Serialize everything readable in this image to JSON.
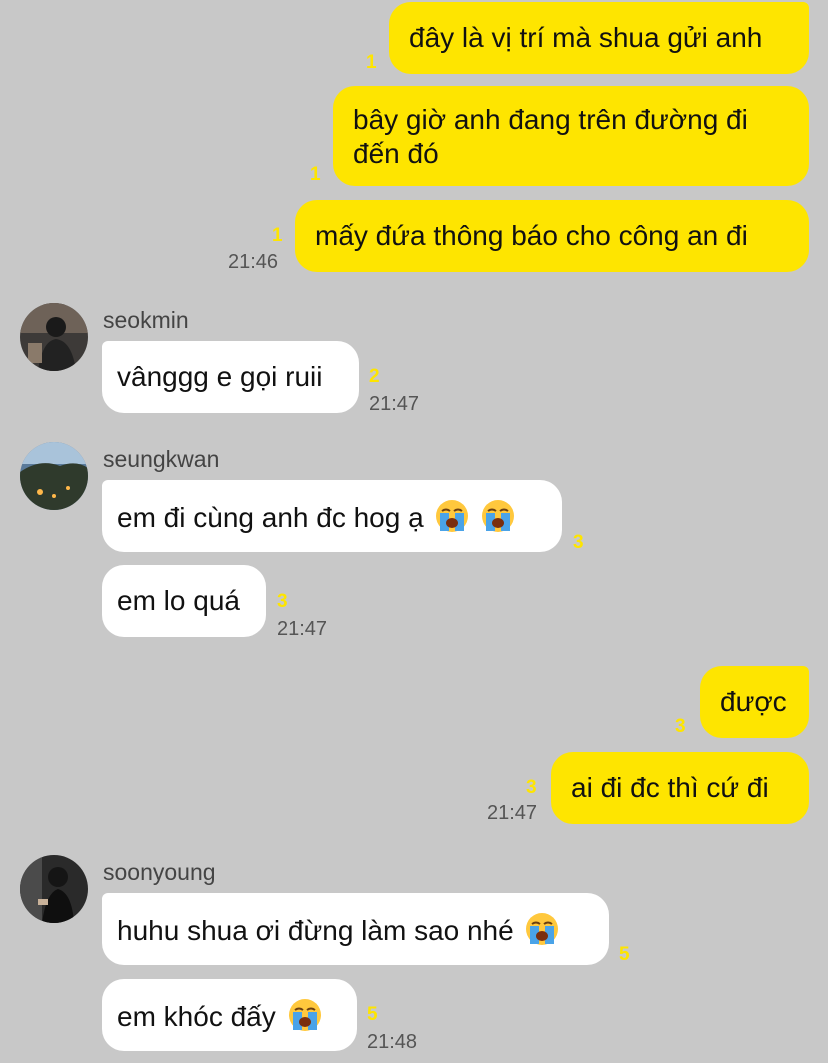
{
  "conversation": {
    "block1": {
      "msg1": "đây là vị trí mà shua gửi anh",
      "msg1_unread": "1",
      "msg2_line1": "bây giờ anh đang trên đường đi",
      "msg2_line2": "đến đó",
      "msg2_unread": "1",
      "msg3": "mấy đứa thông báo cho công an đi",
      "msg3_unread": "1",
      "time": "21:46"
    },
    "seokmin": {
      "name": "seokmin",
      "msg1": "vânggg e gọi ruii",
      "msg1_unread": "2",
      "time": "21:47"
    },
    "seungkwan": {
      "name": "seungkwan",
      "msg1": "em đi cùng anh đc hog ạ",
      "msg1_unread": "3",
      "msg2": "em lo quá",
      "msg2_unread": "3",
      "time": "21:47"
    },
    "block2": {
      "msg1": "được",
      "msg1_unread": "3",
      "msg2": "ai đi đc thì cứ đi",
      "msg2_unread": "3",
      "time": "21:47"
    },
    "soonyoung": {
      "name": "soonyoung",
      "msg1": "huhu shua ơi đừng làm sao nhé",
      "msg1_unread": "5",
      "msg2": "em khóc đấy",
      "msg2_unread": "5",
      "time": "21:48"
    }
  },
  "icons": {
    "emoji": "loudly-crying-face-icon",
    "avatar": "profile-photo"
  },
  "colors": {
    "background": "#c8c8c8",
    "outgoing_bubble": "#fee500",
    "incoming_bubble": "#ffffff",
    "unread_count": "#fee500"
  }
}
